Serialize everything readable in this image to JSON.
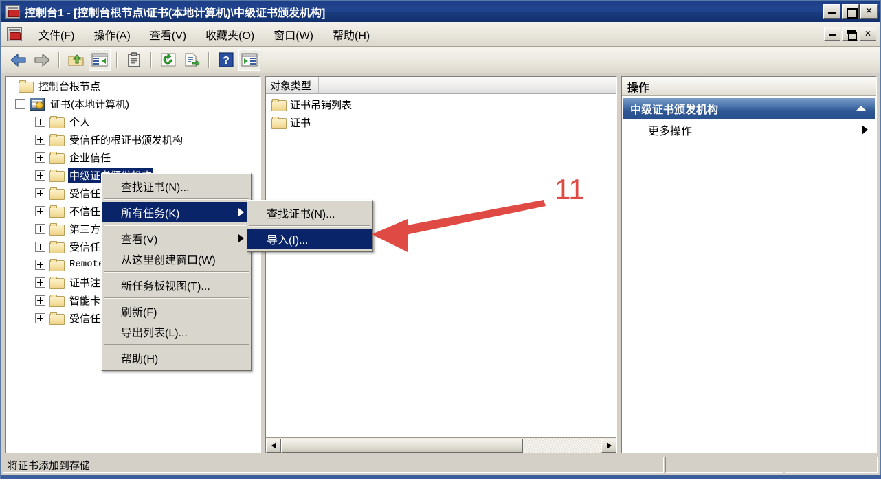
{
  "window": {
    "title": "控制台1 - [控制台根节点\\证书(本地计算机)\\中级证书颁发机构]",
    "app_icon": "mmc-console-icon",
    "buttons": {
      "minimize": "_",
      "maximize": "□",
      "close": "✕"
    },
    "doc_buttons": {
      "minimize": "_",
      "restore": "❐",
      "close": "✕"
    }
  },
  "menubar": {
    "items": [
      {
        "label": "文件(F)"
      },
      {
        "label": "操作(A)"
      },
      {
        "label": "查看(V)"
      },
      {
        "label": "收藏夹(O)"
      },
      {
        "label": "窗口(W)"
      },
      {
        "label": "帮助(H)"
      }
    ]
  },
  "toolbar": {
    "buttons": [
      {
        "name": "back-arrow-icon",
        "glyph": "←"
      },
      {
        "name": "forward-arrow-icon",
        "glyph": "→"
      },
      {
        "name": "up-one-level-icon",
        "glyph": "folder-up"
      },
      {
        "name": "show-hide-tree-icon",
        "glyph": "tree-pane"
      },
      {
        "name": "properties-clipboard-icon",
        "glyph": "clipboard"
      },
      {
        "name": "refresh-icon",
        "glyph": "refresh"
      },
      {
        "name": "export-list-icon",
        "glyph": "export"
      },
      {
        "name": "help-icon",
        "glyph": "?"
      },
      {
        "name": "show-action-pane-icon",
        "glyph": "action-pane"
      }
    ]
  },
  "tree": {
    "nodes": [
      {
        "label": "控制台根节点",
        "icon": "folder-icon",
        "level": 0,
        "expander": "none",
        "selected": false
      },
      {
        "label": "证书(本地计算机)",
        "icon": "certificate-store-icon",
        "level": 0,
        "expander": "minus",
        "selected": false
      },
      {
        "label": "个人",
        "icon": "folder-icon",
        "level": 1,
        "expander": "plus",
        "selected": false
      },
      {
        "label": "受信任的根证书颁发机构",
        "icon": "folder-icon",
        "level": 1,
        "expander": "plus",
        "selected": false
      },
      {
        "label": "企业信任",
        "icon": "folder-icon",
        "level": 1,
        "expander": "plus",
        "selected": false
      },
      {
        "label": "中级证书颁发机构",
        "icon": "folder-icon",
        "level": 1,
        "expander": "plus",
        "selected": true
      },
      {
        "label": "受信任",
        "icon": "folder-icon",
        "level": 1,
        "expander": "plus",
        "selected": false
      },
      {
        "label": "不信任",
        "icon": "folder-icon",
        "level": 1,
        "expander": "plus",
        "selected": false
      },
      {
        "label": "第三方",
        "icon": "folder-icon",
        "level": 1,
        "expander": "plus",
        "selected": false
      },
      {
        "label": "受信任",
        "icon": "folder-icon",
        "level": 1,
        "expander": "plus",
        "selected": false
      },
      {
        "label": "Remote",
        "icon": "folder-icon",
        "level": 1,
        "expander": "plus",
        "selected": false
      },
      {
        "label": "证书注",
        "icon": "folder-icon",
        "level": 1,
        "expander": "plus",
        "selected": false
      },
      {
        "label": "智能卡",
        "icon": "folder-icon",
        "level": 1,
        "expander": "plus",
        "selected": false
      },
      {
        "label": "受信任",
        "icon": "folder-icon",
        "level": 1,
        "expander": "plus",
        "selected": false
      }
    ]
  },
  "list": {
    "column_header": "对象类型",
    "rows": [
      {
        "label": "证书吊销列表",
        "icon": "folder-icon"
      },
      {
        "label": "证书",
        "icon": "folder-icon"
      }
    ]
  },
  "actions": {
    "header": "操作",
    "group_title": "中级证书颁发机构",
    "group_collapse_icon": "chevron-up-icon",
    "items": [
      {
        "label": "更多操作",
        "submenu_icon": "chevron-right-icon"
      }
    ]
  },
  "context_menu": {
    "items": [
      {
        "label": "查找证书(N)...",
        "type": "item",
        "highlighted": false,
        "submenu": false
      },
      {
        "type": "separator"
      },
      {
        "label": "所有任务(K)",
        "type": "item",
        "highlighted": true,
        "submenu": true
      },
      {
        "type": "separator"
      },
      {
        "label": "查看(V)",
        "type": "item",
        "highlighted": false,
        "submenu": true
      },
      {
        "label": "从这里创建窗口(W)",
        "type": "item",
        "highlighted": false,
        "submenu": false
      },
      {
        "type": "separator"
      },
      {
        "label": "新任务板视图(T)...",
        "type": "item",
        "highlighted": false,
        "submenu": false
      },
      {
        "type": "separator"
      },
      {
        "label": "刷新(F)",
        "type": "item",
        "highlighted": false,
        "submenu": false
      },
      {
        "label": "导出列表(L)...",
        "type": "item",
        "highlighted": false,
        "submenu": false
      },
      {
        "type": "separator"
      },
      {
        "label": "帮助(H)",
        "type": "item",
        "highlighted": false,
        "submenu": false
      }
    ],
    "submenu": {
      "items": [
        {
          "label": "查找证书(N)...",
          "type": "item",
          "highlighted": false
        },
        {
          "type": "separator"
        },
        {
          "label": "导入(I)...",
          "type": "item",
          "highlighted": true
        }
      ]
    }
  },
  "statusbar": {
    "message": "将证书添加到存储"
  },
  "annotation": {
    "number": "11",
    "color": "#e04a44",
    "arrow": "left-pointing-arrow"
  }
}
